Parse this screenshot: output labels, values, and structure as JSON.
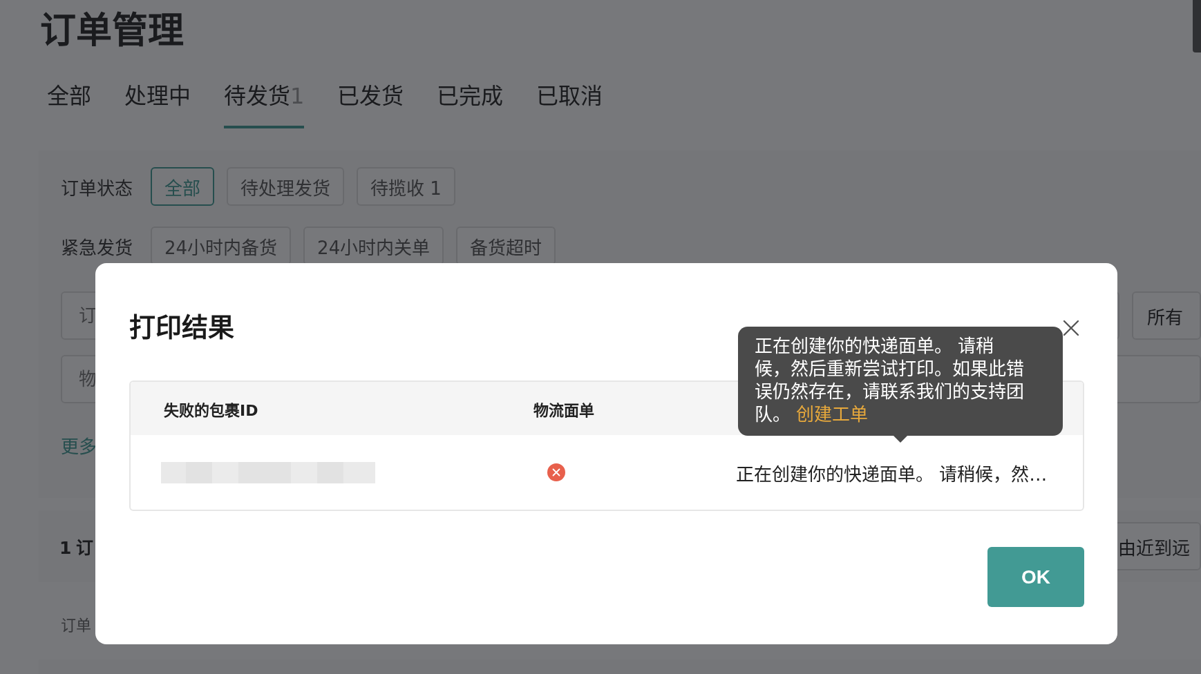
{
  "page": {
    "title": "订单管理"
  },
  "tabs": [
    {
      "label": "全部",
      "selected": false
    },
    {
      "label": "处理中",
      "selected": false
    },
    {
      "label": "待发货",
      "count": "1",
      "selected": true
    },
    {
      "label": "已发货",
      "selected": false
    },
    {
      "label": "已完成",
      "selected": false
    },
    {
      "label": "已取消",
      "selected": false
    }
  ],
  "filters": [
    {
      "label": "订单状态",
      "chips": [
        {
          "label": "全部",
          "selected": true
        },
        {
          "label": "待处理发货",
          "selected": false
        },
        {
          "label": "待揽收 1",
          "selected": false
        }
      ]
    },
    {
      "label": "紧急发货",
      "chips": [
        {
          "label": "24小时内备货",
          "selected": false
        },
        {
          "label": "24小时内关单",
          "selected": false
        },
        {
          "label": "备货超时",
          "selected": false
        }
      ]
    }
  ],
  "search": {
    "order_field": {
      "placeholder": "订"
    },
    "scope_select": {
      "value": "所有"
    },
    "logistics_field": {
      "placeholder": "物"
    }
  },
  "more_link": "更多",
  "results_bar": {
    "count_text": "1 订",
    "sort_select": "由近到远"
  },
  "list_header": "订单",
  "dialog": {
    "title": "打印结果",
    "columns": [
      "失败的包裹ID",
      "物流面单"
    ],
    "rows": [
      {
        "label_failed": true,
        "message": "正在创建你的快递面单。 请稍候，然…"
      }
    ],
    "tooltip": {
      "text": "正在创建你的快递面单。 请稍候，然后重新尝试打印。如果此错误仍然存在，请联系我们的支持团队。",
      "link": "创建工单"
    },
    "ok_button": "OK"
  }
}
